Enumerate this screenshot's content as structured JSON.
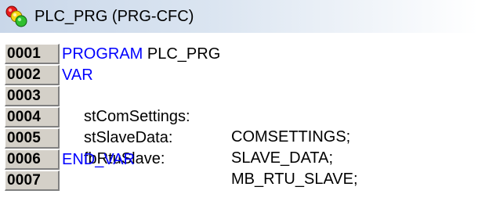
{
  "window": {
    "title": "PLC_PRG (PRG-CFC)",
    "icon": "pou-traffic-light-icon"
  },
  "editor": {
    "lines": [
      {
        "number": "0001",
        "keyword": "PROGRAM",
        "rest": " PLC_PRG"
      },
      {
        "number": "0002",
        "keyword": "VAR",
        "rest": ""
      },
      {
        "number": "0003",
        "name": "stComSettings:",
        "type": "COMSETTINGS;"
      },
      {
        "number": "0004",
        "name": "stSlaveData:",
        "type": "SLAVE_DATA;"
      },
      {
        "number": "0005",
        "name": "fbRtuSlave:",
        "type": "MB_RTU_SLAVE;"
      },
      {
        "number": "0006",
        "keyword": "END_VAR",
        "rest": ""
      },
      {
        "number": "0007",
        "keyword": "",
        "rest": ""
      }
    ]
  },
  "colors": {
    "keyword": "#0000ff",
    "gutter_bg": "#d4d0c8",
    "titlebar_start": "#c9d7e9"
  }
}
